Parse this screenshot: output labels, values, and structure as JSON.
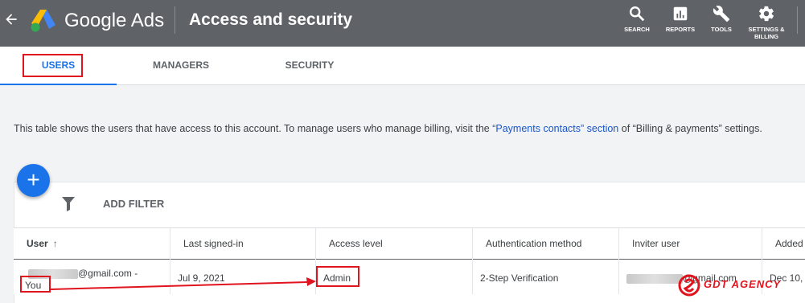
{
  "header": {
    "brand": "Google Ads",
    "title": "Access and security",
    "tools": [
      {
        "icon": "search-icon",
        "label": "SEARCH"
      },
      {
        "icon": "reports-icon",
        "label": "REPORTS"
      },
      {
        "icon": "tools-icon",
        "label": "TOOLS"
      },
      {
        "icon": "gear-icon",
        "label": "SETTINGS &\nBILLING"
      }
    ]
  },
  "tabs": [
    {
      "label": "USERS",
      "active": true
    },
    {
      "label": "MANAGERS",
      "active": false
    },
    {
      "label": "SECURITY",
      "active": false
    }
  ],
  "info": {
    "before": "This table shows the users that have access to this account. To manage users who manage billing, visit the ",
    "link1": "“Payments contacts”",
    "link2": "section",
    "after": " of “Billing & payments” settings."
  },
  "toolbar": {
    "add_button": "+",
    "add_filter": "ADD FILTER"
  },
  "table": {
    "headers": [
      "User",
      "Last signed-in",
      "Access level",
      "Authentication method",
      "Inviter user",
      "Added o"
    ],
    "sort_arrow": "↑",
    "rows": [
      {
        "user_email": "@gmail.com -",
        "user_you": "You",
        "last_signed_in": "Jul 9, 2021",
        "access_level": "Admin",
        "auth_method": "2-Step Verification",
        "inviter": "@gmail.com",
        "added_on": "Dec 10,"
      }
    ]
  },
  "watermark": {
    "text": "GDT AGENCY"
  },
  "colors": {
    "header_bg": "#5f6368",
    "accent": "#1a73e8",
    "highlight": "#e0141e"
  }
}
